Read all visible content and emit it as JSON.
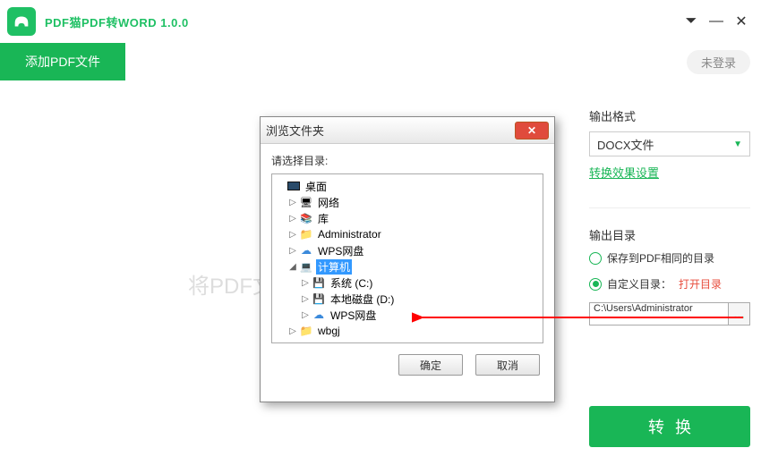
{
  "app": {
    "title": "PDF猫PDF转WORD 1.0.0"
  },
  "toolbar": {
    "add_label": "添加PDF文件",
    "login_label": "未登录"
  },
  "dropzone": {
    "hint": "将PDF文"
  },
  "output_format": {
    "section_label": "输出格式",
    "selected": "DOCX文件",
    "settings_link": "转换效果设置"
  },
  "output_dir": {
    "section_label": "输出目录",
    "opt_same": "保存到PDF相同的目录",
    "opt_custom": "自定义目录：",
    "open_dir_link": "打开目录",
    "path": "C:\\Users\\Administrator",
    "browse": "..."
  },
  "convert": {
    "label": "转换"
  },
  "dialog": {
    "title": "浏览文件夹",
    "prompt": "请选择目录:",
    "ok": "确定",
    "cancel": "取消",
    "tree": {
      "desktop": "桌面",
      "network": "网络",
      "library": "库",
      "administrator": "Administrator",
      "wps": "WPS网盘",
      "computer": "计算机",
      "drive_c": "系统 (C:)",
      "drive_d": "本地磁盘 (D:)",
      "wps2": "WPS网盘",
      "wbgj": "wbgj"
    }
  }
}
